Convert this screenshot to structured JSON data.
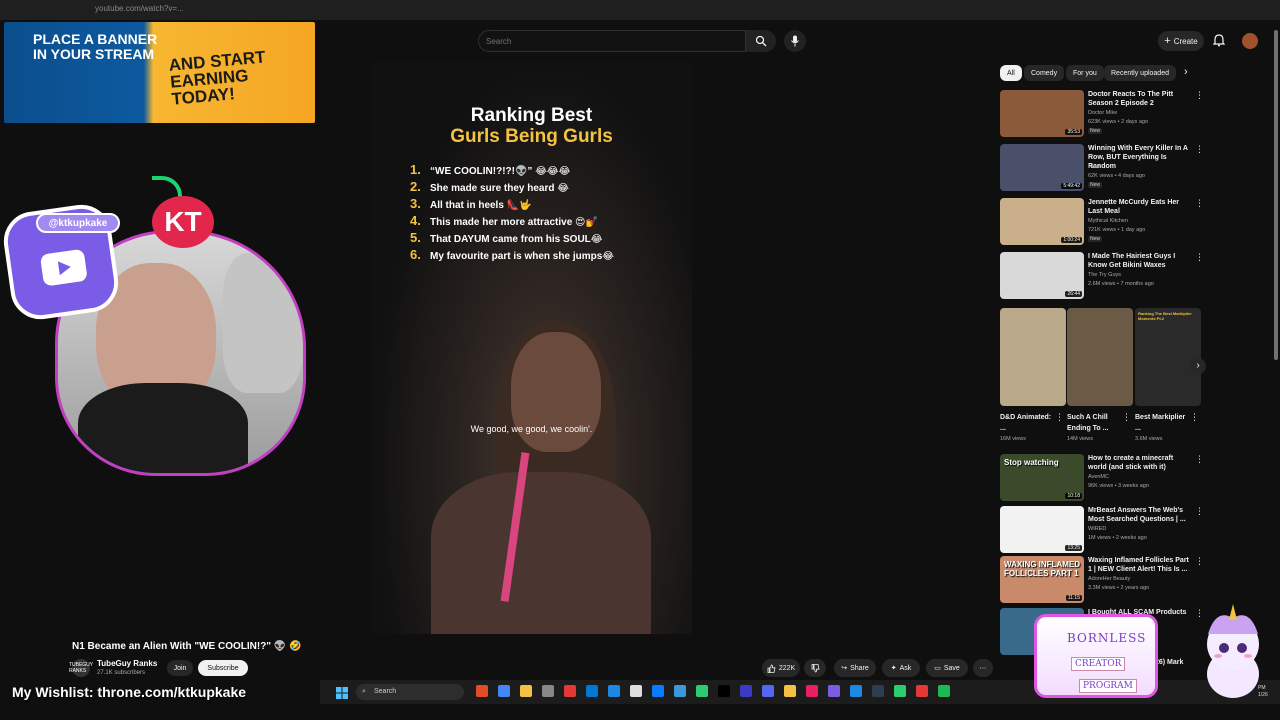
{
  "browser": {
    "url_text": "youtube.com/watch?v=..."
  },
  "banner": {
    "left_text": "PLACE A BANNER IN YOUR STREAM",
    "right_text": "AND START EARNING TODAY!"
  },
  "topbar": {
    "search_placeholder": "Search",
    "create_label": "Create"
  },
  "video": {
    "title_line1": "Ranking Best",
    "title_line2": "Gurls Being Gurls",
    "rank_color": "#f4c242",
    "items": [
      {
        "num": "1.",
        "text": "“WE COOLIN!?!?!👽” 😂😂😂"
      },
      {
        "num": "2.",
        "text": "She made sure they heard 😂"
      },
      {
        "num": "3.",
        "text": "All that in heels 👠🤟"
      },
      {
        "num": "4.",
        "text": "This made her more attractive 😍💅"
      },
      {
        "num": "5.",
        "text": "That DAYUM came from his SOUL😂"
      },
      {
        "num": "6.",
        "text": "My favourite part is when she jumps😂"
      }
    ],
    "caption": "We good, we good, we coolin'."
  },
  "stream_overlay": {
    "handle": "@ktkupkake",
    "badge": "KT",
    "wishlist": "My Wishlist: throne.com/ktkupkake",
    "sponsor_line1": "BORNLESS",
    "sponsor_line2": "CREATOR",
    "sponsor_line3": "PROGRAM"
  },
  "watch": {
    "title": "N1 Became an Alien With \"WE COOLIN!?\" 👽 🤣",
    "channel_avatar_text": "TUBEGUY RANKS",
    "channel_name": "TubeGuy Ranks",
    "subscribers": "27.1K subscribers",
    "join_label": "Join",
    "subscribe_label": "Subscribe",
    "likes": "222K",
    "share_label": "Share",
    "ask_label": "Ask",
    "save_label": "Save"
  },
  "sidebar": {
    "chips": [
      "All",
      "Comedy",
      "For you",
      "Recently uploaded"
    ],
    "recs_top": [
      {
        "title": "Doctor Reacts To The Pitt Season 2 Episode 2",
        "channel": "Doctor Mike",
        "meta": "623K views • 2 days ago",
        "badge": "New",
        "duration": "35:53",
        "thumb_color": "#8a5a3a"
      },
      {
        "title": "Winning With Every Killer In A Row, BUT Everything Is Random",
        "channel": "Hens",
        "meta": "62K views • 4 days ago",
        "badge": "New",
        "duration": "5:49:42",
        "thumb_color": "#4a4f6a"
      },
      {
        "title": "Jennette McCurdy Eats Her Last Meal",
        "channel": "Mythical Kitchen",
        "meta": "721K views • 1 day ago",
        "badge": "New",
        "duration": "1:00:24",
        "thumb_color": "#c9b08a"
      },
      {
        "title": "I Made The Hairiest Guys I Know Get Bikini Waxes",
        "channel": "The Try Guys",
        "meta": "2.6M views • 7 months ago",
        "badge": "",
        "duration": "26:44",
        "thumb_color": "#d9d9d9"
      }
    ],
    "shorts": [
      {
        "title": "D&D Animated: ...",
        "views": "16M views",
        "thumb_color": "#b9a88a"
      },
      {
        "title": "Such A Chill Ending To ...",
        "views": "14M views",
        "thumb_color": "#6a5a46"
      },
      {
        "title": "Best Markiplier ...",
        "views": "3.6M views",
        "thumb_color": "#2a2a2a",
        "overlay": "Ranking The Best Markiplier Moments Pt.2"
      }
    ],
    "recs_bottom": [
      {
        "title": "How to create a minecraft world (and stick with it)",
        "channel": "AvenMC",
        "meta": "96K views • 3 weeks ago",
        "duration": "10:18",
        "thumb_color": "#3a4a2a",
        "overlay": "Stop watching"
      },
      {
        "title": "MrBeast Answers The Web's Most Searched Questions | ...",
        "channel": "WIRED",
        "meta": "1M views • 2 weeks ago",
        "duration": "13:25",
        "thumb_color": "#f2f2f2"
      },
      {
        "title": "Waxing Inflamed Follicles Part 1 | NEW Client Alert! This Is ...",
        "channel": "AdoreHer Beauty",
        "meta": "3.3M views • 2 years ago",
        "duration": "11:15",
        "thumb_color": "#c98a6a",
        "overlay": "WAXING INFLAMED FOLLICLES PART 1"
      },
      {
        "title": "I Bought ALL SCAM Products to ...",
        "channel": "",
        "meta": "",
        "duration": "",
        "thumb_color": "#3a6a8a"
      }
    ],
    "partial_title": "26) Mark"
  },
  "taskbar": {
    "search_label": "Search",
    "time": "PM",
    "date": "1/26"
  }
}
